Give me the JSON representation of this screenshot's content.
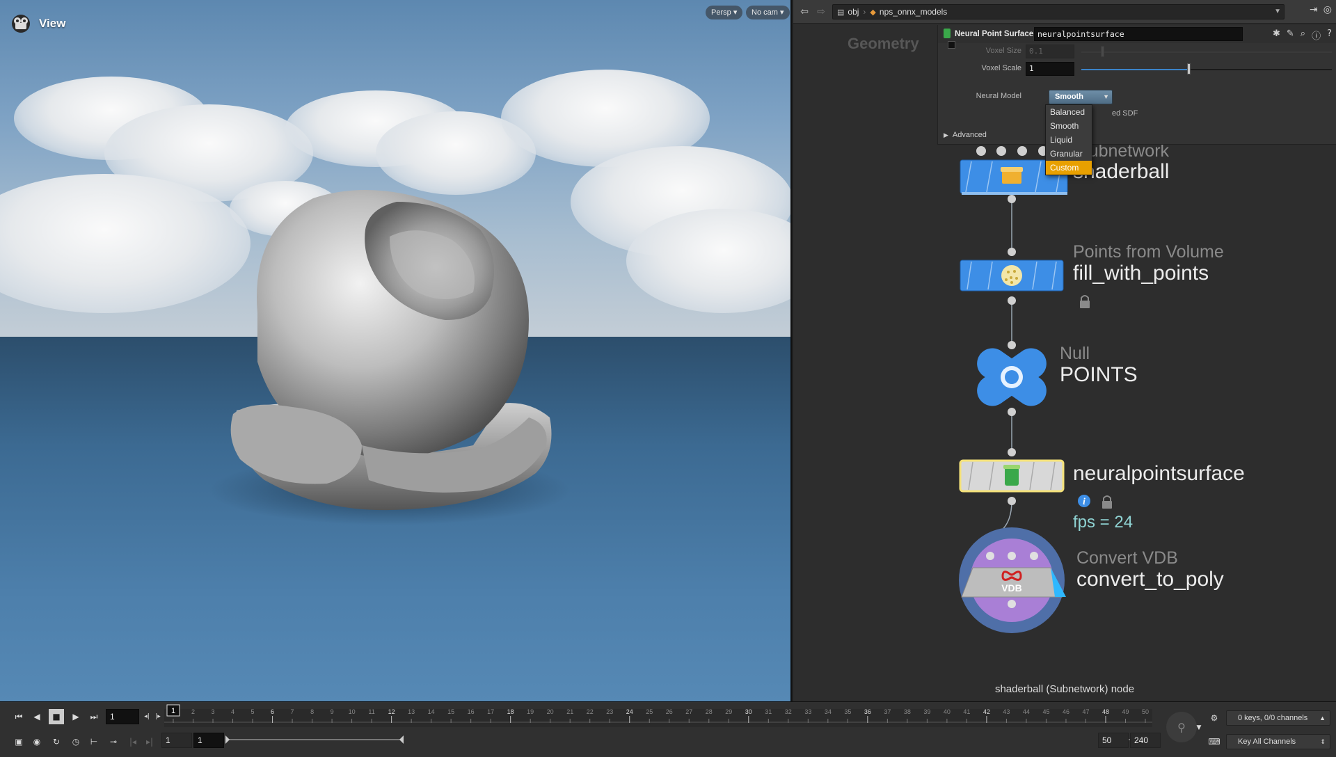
{
  "viewport": {
    "title": "View",
    "projection_label": "Persp",
    "camera_label": "No cam"
  },
  "network": {
    "path": {
      "root": "obj",
      "current": "nps_onnx_models"
    },
    "context_label": "Geometry",
    "params": {
      "node_type": "Neural Point Surface",
      "node_name": "neuralpointsurface",
      "voxel_size_label": "Voxel Size",
      "voxel_size_value": "0.1",
      "voxel_scale_label": "Voxel Scale",
      "voxel_scale_value": "1",
      "voxel_scale_slider_fraction": 0.38,
      "neural_model_label": "Neural Model",
      "neural_model_value": "Smooth",
      "partial_text": "ed SDF",
      "advanced_label": "Advanced"
    },
    "menu": {
      "items": [
        "Balanced",
        "Smooth",
        "Liquid",
        "Granular",
        "Custom"
      ],
      "highlighted": "Custom"
    },
    "nodes": [
      {
        "type": "Subnetwork",
        "name": "shaderball"
      },
      {
        "type": "Points from Volume",
        "name": "fill_with_points"
      },
      {
        "type": "Null",
        "name": "POINTS"
      },
      {
        "type": "",
        "name": "neuralpointsurface"
      },
      {
        "type": "Convert VDB",
        "name": "convert_to_poly"
      }
    ],
    "vdb_badge": "VDB",
    "fps_text": "fps = 24",
    "status": "shaderball (Subnetwork) node"
  },
  "timeline": {
    "current_frame": "1",
    "ruler_marker": "1",
    "ticks": [
      1,
      2,
      3,
      4,
      5,
      6,
      7,
      8,
      9,
      10,
      11,
      12,
      13,
      14,
      15,
      16,
      17,
      18,
      19,
      20,
      21,
      22,
      23,
      24,
      25,
      26,
      27,
      28,
      29,
      30,
      31,
      32,
      33,
      34,
      35,
      36,
      37,
      38,
      39,
      40,
      41,
      42,
      43,
      44,
      45,
      46,
      47,
      48,
      49,
      50
    ],
    "range_start": "1",
    "range_start2": "1",
    "range_end": "50",
    "range_end2": "240",
    "keys_label": "0 keys, 0/0 channels",
    "channels_label": "Key All Channels"
  },
  "colors": {
    "node_blue": "#3d8ee6",
    "node_selected_border": "#f5e27a",
    "menu_highlight": "#e8a000",
    "fps_text": "#8fd3d3"
  }
}
